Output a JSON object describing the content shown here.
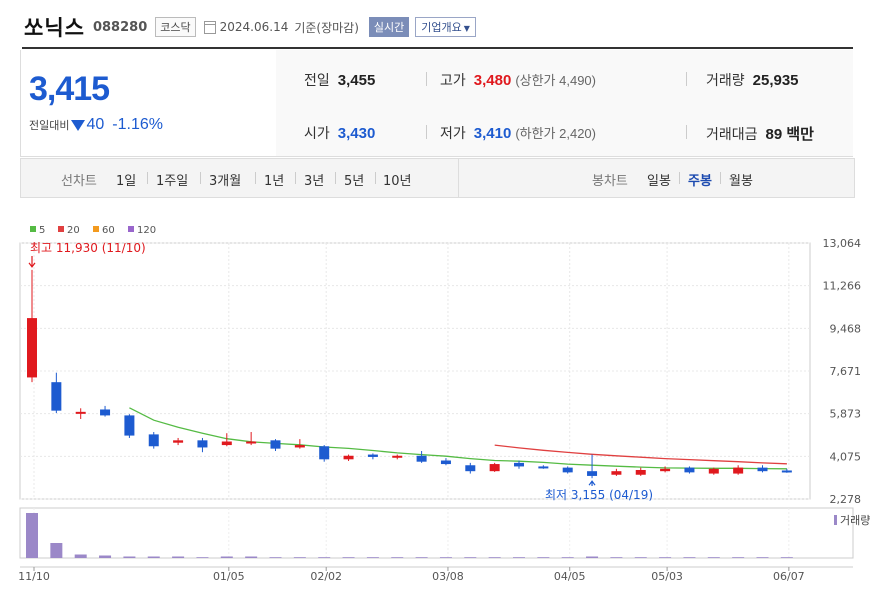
{
  "header": {
    "name": "쏘닉스",
    "code": "088280",
    "market": "코스닥",
    "date": "2024.06.14",
    "basis": "기준(장마감)",
    "realtime_button": "실시간",
    "company_info_button": "기업개요"
  },
  "quote": {
    "price": "3,415",
    "change_label": "전일대비",
    "change_value": "40",
    "change_pct": "-1.16%",
    "prev_label": "전일",
    "prev": "3,455",
    "open_label": "시가",
    "open": "3,430",
    "high_label": "고가",
    "high": "3,480",
    "upper_limit": "(상한가 4,490)",
    "low_label": "저가",
    "low": "3,410",
    "lower_limit": "(하한가 2,420)",
    "volume_label": "거래량",
    "volume": "25,935",
    "amount_label": "거래대금",
    "amount": "89 백만"
  },
  "periods": {
    "line_label": "선차트",
    "line_items": [
      "1일",
      "1주일",
      "3개월",
      "1년",
      "3년",
      "5년",
      "10년"
    ],
    "candle_label": "봉차트",
    "candle_items": [
      "일봉",
      "주봉",
      "월봉"
    ],
    "candle_selected": "주봉"
  },
  "colors": {
    "up": "#e0191e",
    "down": "#1d5bd0",
    "ma5": "#55bb44",
    "ma20": "#e04040",
    "ma60": "#f39a1e",
    "ma120": "#9966cc",
    "volume": "#9b88c8"
  },
  "chart_data": {
    "type": "candlestick",
    "legend": [
      {
        "name": "5",
        "color": "#55bb44"
      },
      {
        "name": "20",
        "color": "#e04040"
      },
      {
        "name": "60",
        "color": "#f39a1e"
      },
      {
        "name": "120",
        "color": "#9966cc"
      }
    ],
    "yticks": [
      2278,
      4075,
      5873,
      7671,
      9468,
      11266,
      13064
    ],
    "ylim": [
      2278,
      13064
    ],
    "xticks": [
      "11/10",
      "01/05",
      "02/02",
      "03/08",
      "04/05",
      "05/03",
      "06/07"
    ],
    "xtick_index": [
      0,
      8,
      12,
      17,
      22,
      26,
      31
    ],
    "annotations": {
      "high": {
        "label": "최고 11,930 (11/10)",
        "value": 11930,
        "index": 0
      },
      "low": {
        "label": "최저 3,155 (04/19)",
        "value": 3155,
        "index": 23
      }
    },
    "volume_label": "거래량",
    "candles": [
      {
        "o": 7400,
        "h": 11930,
        "l": 7200,
        "c": 9900
      },
      {
        "o": 7200,
        "h": 7600,
        "l": 5900,
        "c": 6000
      },
      {
        "o": 5900,
        "h": 6100,
        "l": 5650,
        "c": 5950
      },
      {
        "o": 6050,
        "h": 6200,
        "l": 5750,
        "c": 5800
      },
      {
        "o": 5800,
        "h": 5850,
        "l": 4850,
        "c": 4950
      },
      {
        "o": 5000,
        "h": 5100,
        "l": 4400,
        "c": 4500
      },
      {
        "o": 4650,
        "h": 4850,
        "l": 4550,
        "c": 4750
      },
      {
        "o": 4750,
        "h": 4850,
        "l": 4250,
        "c": 4450
      },
      {
        "o": 4550,
        "h": 5050,
        "l": 4500,
        "c": 4700
      },
      {
        "o": 4650,
        "h": 5100,
        "l": 4550,
        "c": 4700
      },
      {
        "o": 4750,
        "h": 4800,
        "l": 4300,
        "c": 4400
      },
      {
        "o": 4450,
        "h": 4800,
        "l": 4400,
        "c": 4550
      },
      {
        "o": 4500,
        "h": 4550,
        "l": 3850,
        "c": 3950
      },
      {
        "o": 3950,
        "h": 4150,
        "l": 3880,
        "c": 4100
      },
      {
        "o": 4150,
        "h": 4200,
        "l": 3950,
        "c": 4050
      },
      {
        "o": 4050,
        "h": 4150,
        "l": 3950,
        "c": 4100
      },
      {
        "o": 4100,
        "h": 4300,
        "l": 3800,
        "c": 3850
      },
      {
        "o": 3900,
        "h": 4000,
        "l": 3700,
        "c": 3750
      },
      {
        "o": 3700,
        "h": 3800,
        "l": 3350,
        "c": 3450
      },
      {
        "o": 3450,
        "h": 3800,
        "l": 3420,
        "c": 3750
      },
      {
        "o": 3800,
        "h": 3900,
        "l": 3550,
        "c": 3650
      },
      {
        "o": 3650,
        "h": 3700,
        "l": 3550,
        "c": 3600
      },
      {
        "o": 3600,
        "h": 3650,
        "l": 3350,
        "c": 3400
      },
      {
        "o": 3450,
        "h": 4150,
        "l": 3155,
        "c": 3250
      },
      {
        "o": 3300,
        "h": 3550,
        "l": 3250,
        "c": 3450
      },
      {
        "o": 3300,
        "h": 3600,
        "l": 3250,
        "c": 3500
      },
      {
        "o": 3450,
        "h": 3650,
        "l": 3400,
        "c": 3550
      },
      {
        "o": 3600,
        "h": 3650,
        "l": 3350,
        "c": 3400
      },
      {
        "o": 3350,
        "h": 3600,
        "l": 3300,
        "c": 3550
      },
      {
        "o": 3350,
        "h": 3700,
        "l": 3300,
        "c": 3600
      },
      {
        "o": 3600,
        "h": 3700,
        "l": 3400,
        "c": 3450
      },
      {
        "o": 3480,
        "h": 3550,
        "l": 3380,
        "c": 3415
      }
    ],
    "ma5": [
      null,
      null,
      null,
      null,
      6120,
      5600,
      5300,
      5050,
      4820,
      4690,
      4620,
      4560,
      4470,
      4410,
      4320,
      4220,
      4150,
      4080,
      3980,
      3900,
      3870,
      3820,
      3750,
      3700,
      3660,
      3620,
      3590,
      3580,
      3570,
      3570,
      3560,
      3550
    ],
    "ma20": [
      null,
      null,
      null,
      null,
      null,
      null,
      null,
      null,
      null,
      null,
      null,
      null,
      null,
      null,
      null,
      null,
      null,
      null,
      null,
      4550,
      4430,
      4330,
      4240,
      4160,
      4100,
      4040,
      3980,
      3940,
      3890,
      3850,
      3800,
      3760
    ],
    "volume": [
      90,
      30,
      7,
      5,
      3,
      2,
      1,
      0,
      1,
      1,
      0,
      0,
      0,
      0,
      0,
      0,
      0,
      0,
      0,
      0,
      0,
      0,
      0,
      1,
      0,
      0,
      0,
      0,
      0,
      0,
      0,
      0
    ]
  }
}
